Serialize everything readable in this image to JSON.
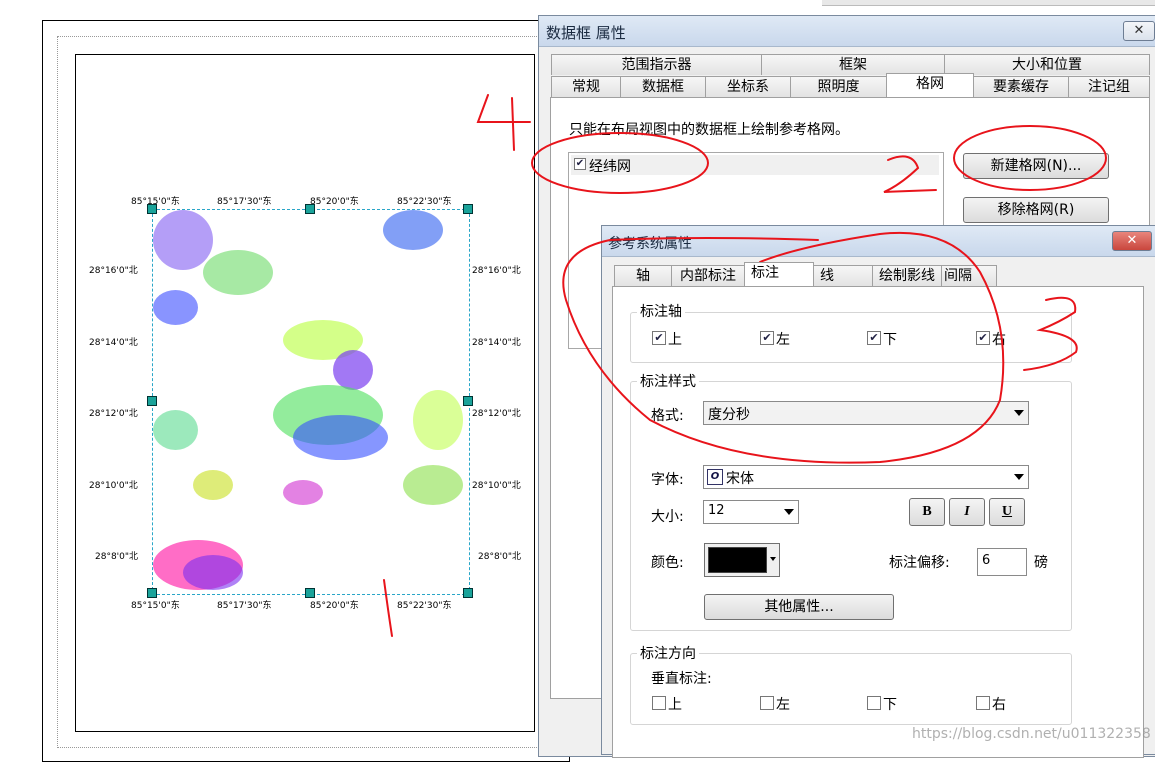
{
  "layout_ticks": {
    "top": [
      "85°15'0\"东",
      "85°17'30\"东",
      "85°20'0\"东",
      "85°22'30\"东"
    ],
    "bottom": [
      "85°15'0\"东",
      "85°17'30\"东",
      "85°20'0\"东",
      "85°22'30\"东"
    ],
    "left": [
      "28°16'0\"北",
      "28°14'0\"北",
      "28°12'0\"北",
      "28°10'0\"北",
      "28°8'0\"北"
    ],
    "right": [
      "28°16'0\"北",
      "28°14'0\"北",
      "28°12'0\"北",
      "28°10'0\"北",
      "28°8'0\"北"
    ]
  },
  "outer_dialog": {
    "title": "数据框 属性",
    "close": "✕",
    "tabs_row1": [
      "范围指示器",
      "框架",
      "大小和位置"
    ],
    "tabs_row2": [
      "常规",
      "数据框",
      "坐标系",
      "照明度",
      "格网",
      "要素缓存",
      "注记组"
    ],
    "note": "只能在布局视图中的数据框上绘制参考格网。",
    "grid_item": "经纬网",
    "grid_checked": "✔",
    "new_grid_button": "新建格网(N)...",
    "remove_grid_button": "移除格网(R)"
  },
  "inner_dialog": {
    "title": "参考系统属性",
    "close": "✕",
    "tabs": [
      "轴",
      "内部标注",
      "标注",
      "线",
      "绘制影线",
      "间隔"
    ],
    "label_axes": {
      "title": "标注轴",
      "options": [
        {
          "label": "上",
          "checked": "✔"
        },
        {
          "label": "左",
          "checked": "✔"
        },
        {
          "label": "下",
          "checked": "✔"
        },
        {
          "label": "右",
          "checked": "✔"
        }
      ]
    },
    "label_style": {
      "title": "标注样式",
      "format_label": "格式:",
      "format_value": "度分秒",
      "font_label": "字体:",
      "font_icon": "O",
      "font_value": "宋体",
      "size_label": "大小:",
      "size_value": "12",
      "bold": "B",
      "italic": "I",
      "underline": "U",
      "color_label": "颜色:",
      "color_value": "#000000",
      "offset_label": "标注偏移:",
      "offset_value": "6",
      "offset_unit": "磅",
      "more_button": "其他属性..."
    },
    "label_direction": {
      "title": "标注方向",
      "vertical_label": "垂直标注:",
      "options": [
        "上",
        "左",
        "下",
        "右"
      ]
    }
  },
  "watermark": "https://blog.csdn.net/u011322358",
  "colors": {
    "dialog_bg": "#f0f0f0",
    "title_gradient_top": "#dfe9f5",
    "close_red": "#c9463d",
    "annotation_red": "#e8141b",
    "map_selection": "#2aa6c8"
  }
}
